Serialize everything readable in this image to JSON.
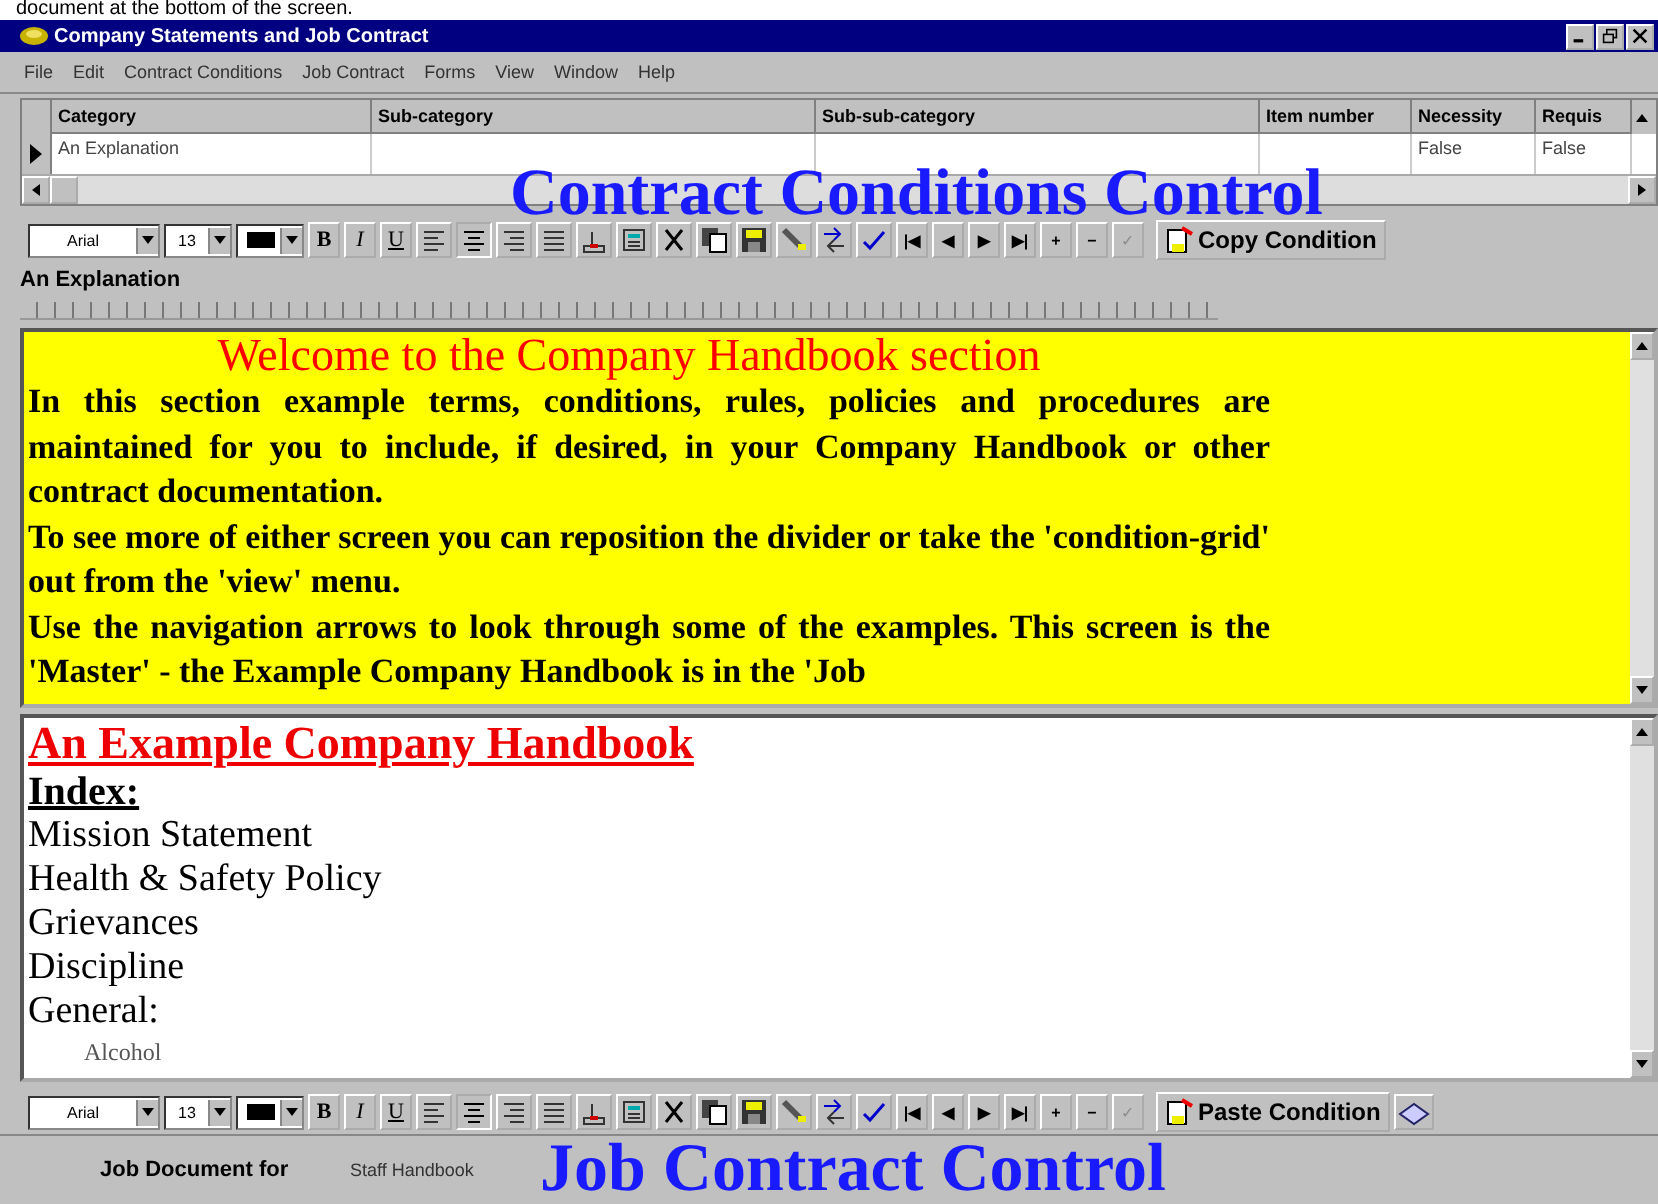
{
  "caption": "document at the bottom of the screen.",
  "window": {
    "title": "Company Statements and Job Contract"
  },
  "menu": [
    "File",
    "Edit",
    "Contract Conditions",
    "Job Contract",
    "Forms",
    "View",
    "Window",
    "Help"
  ],
  "grid": {
    "columns": [
      "Category",
      "Sub-category",
      "Sub-sub-category",
      "Item number",
      "Necessity",
      "Requis"
    ],
    "rows": [
      {
        "selected": true,
        "cells": [
          "An Explanation",
          "",
          "",
          "",
          "False",
          "False"
        ]
      }
    ],
    "banner": "Contract Conditions Control"
  },
  "toolbar_top": {
    "font": "Arial",
    "size": "13",
    "format": [
      "B",
      "I",
      "U"
    ],
    "nav": [
      {
        "label": "|◀",
        "disabled": false
      },
      {
        "label": "◀",
        "disabled": false
      },
      {
        "label": "▶",
        "disabled": false
      },
      {
        "label": "▶|",
        "disabled": false
      },
      {
        "label": "+",
        "disabled": false
      },
      {
        "label": "−",
        "disabled": false
      },
      {
        "label": "✓",
        "disabled": true
      }
    ],
    "action": "Copy Condition"
  },
  "section_label": "An Explanation",
  "explanation": {
    "title": "Welcome to the Company Handbook section",
    "paragraphs": [
      "In this section example terms, conditions, rules, policies and procedures are maintained for you to include, if desired, in your Company Handbook or other contract documentation.",
      "To see more of either screen you can reposition the divider or take the 'condition-grid' out from the 'view' menu.",
      "Use the navigation arrows to look through some of the examples. This screen is the 'Master' - the Example Company Handbook is in the 'Job"
    ]
  },
  "document": {
    "title": "An Example Company Handbook",
    "index_label": "Index:",
    "items": [
      "Mission Statement",
      "Health & Safety Policy",
      "Grievances",
      "Discipline",
      "General:"
    ],
    "subitems": [
      "Alcohol"
    ]
  },
  "toolbar_bottom": {
    "font": "Arial",
    "size": "13",
    "format": [
      "B",
      "I",
      "U"
    ],
    "nav": [
      {
        "label": "|◀",
        "disabled": false
      },
      {
        "label": "◀",
        "disabled": false
      },
      {
        "label": "▶",
        "disabled": false
      },
      {
        "label": "▶|",
        "disabled": false
      },
      {
        "label": "+",
        "disabled": false
      },
      {
        "label": "−",
        "disabled": false
      },
      {
        "label": "✓",
        "disabled": true
      }
    ],
    "action": "Paste Condition"
  },
  "footer": {
    "label": "Job Document for",
    "value": "Staff Handbook",
    "banner": "Job Contract Control"
  }
}
